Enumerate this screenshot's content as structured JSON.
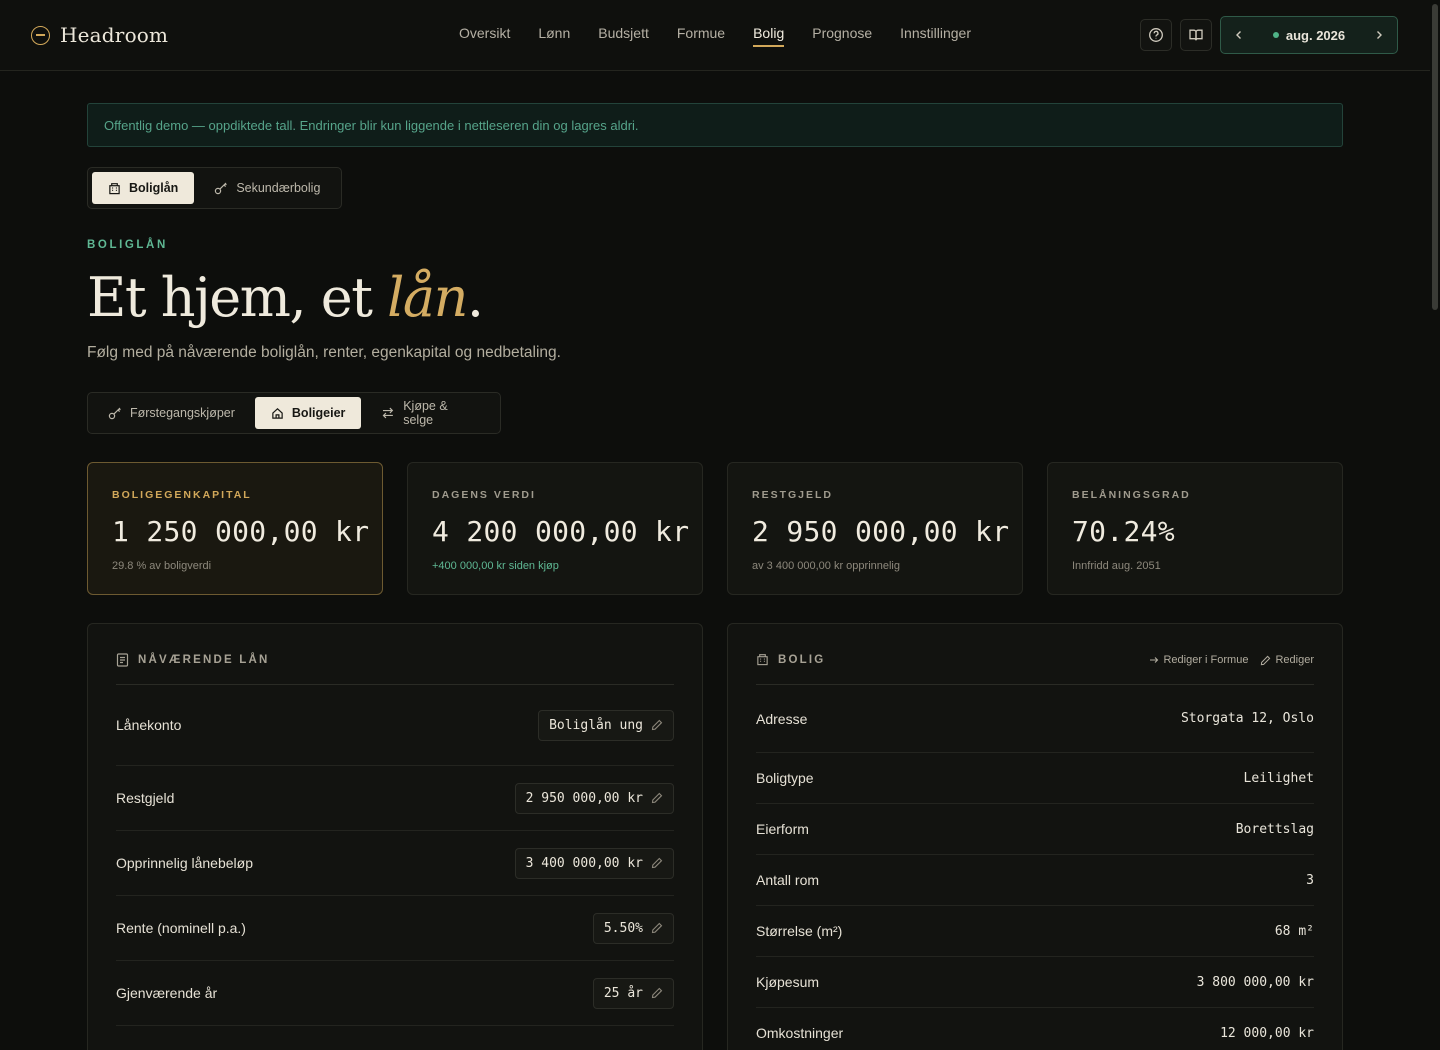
{
  "app": {
    "name": "Headroom"
  },
  "nav": {
    "items": [
      "Oversikt",
      "Lønn",
      "Budsjett",
      "Formue",
      "Bolig",
      "Prognose",
      "Innstillinger"
    ],
    "active": "Bolig"
  },
  "toolbar": {
    "month": "aug. 2026"
  },
  "banner": {
    "text": "Offentlig demo — oppdiktede tall. Endringer blir kun liggende i nettleseren din og lagres aldri."
  },
  "tabs": {
    "main": [
      {
        "label": "Boliglån",
        "icon": "building-icon"
      },
      {
        "label": "Sekundærbolig",
        "icon": "key-icon"
      }
    ],
    "mode": [
      {
        "label": "Førstegangskjøper",
        "icon": "key-icon"
      },
      {
        "label": "Boligeier",
        "icon": "home-icon"
      },
      {
        "label": "Kjøpe & selge",
        "icon": "swap-icon"
      }
    ]
  },
  "page": {
    "eyebrow": "BOLIGLÅN",
    "title_pre": "Et hjem, et ",
    "title_accent": "lån",
    "title_post": ".",
    "lead": "Følg med på nåværende boliglån, renter, egenkapital og nedbetaling."
  },
  "stats": [
    {
      "label": "BOLIGEGENKAPITAL",
      "value": "1 250 000,00 kr",
      "sub": "29.8 % av boligverdi"
    },
    {
      "label": "DAGENS VERDI",
      "value": "4 200 000,00 kr",
      "sub": "+400 000,00 kr siden kjøp"
    },
    {
      "label": "RESTGJELD",
      "value": "2 950 000,00 kr",
      "sub": "av 3 400 000,00 kr opprinnelig"
    },
    {
      "label": "BELÅNINGSGRAD",
      "value": "70.24%",
      "sub": "Innfridd aug. 2051"
    }
  ],
  "loan_panel": {
    "title": "NÅVÆRENDE LÅN",
    "rows": [
      {
        "label": "Lånekonto",
        "value": "Boliglån ung"
      },
      {
        "label": "Restgjeld",
        "value": "2 950 000,00 kr"
      },
      {
        "label": "Opprinnelig lånebeløp",
        "value": "3 400 000,00 kr"
      },
      {
        "label": "Rente (nominell p.a.)",
        "value": "5.50%"
      },
      {
        "label": "Gjenværende år",
        "value": "25 år"
      }
    ]
  },
  "home_panel": {
    "title": "BOLIG",
    "action_formue": "Rediger i Formue",
    "action_edit": "Rediger",
    "rows": [
      {
        "label": "Adresse",
        "value": "Storgata 12, Oslo"
      },
      {
        "label": "Boligtype",
        "value": "Leilighet"
      },
      {
        "label": "Eierform",
        "value": "Borettslag"
      },
      {
        "label": "Antall rom",
        "value": "3"
      },
      {
        "label": "Størrelse (m²)",
        "value": "68 m²"
      },
      {
        "label": "Kjøpesum",
        "value": "3 800 000,00 kr"
      },
      {
        "label": "Omkostninger",
        "value": "12 000,00 kr"
      }
    ]
  },
  "colors": {
    "accent": "#d2a85a",
    "positive": "#5fb894",
    "background": "#0d0e0c"
  }
}
